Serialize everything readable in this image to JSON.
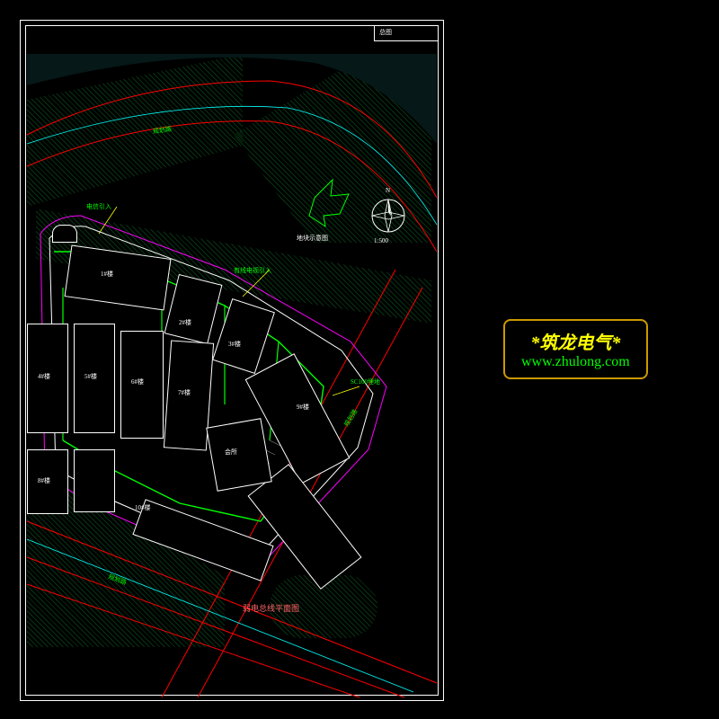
{
  "domain": "Diagram",
  "description": "CAD site plan — electrical weak-current layout of a residential/commercial block",
  "watermark": {
    "title": "*筑龙电气*",
    "url": "www.zhulong.com"
  },
  "title_block": {
    "label": "总图"
  },
  "compass": {
    "scale": "1:500",
    "north": "N"
  },
  "legend_label": "地块示意图",
  "plan_title": "弱电总线平面图",
  "buildings": {
    "b1": "1#楼",
    "b2": "2#楼",
    "b3": "3#楼",
    "b4": "4#楼",
    "b5": "5#楼",
    "b6": "6#楼",
    "b7": "7#楼",
    "b8": "8#楼",
    "b9": "9#楼",
    "b10": "10#楼",
    "hall": "会所"
  },
  "roads": {
    "r1": "规划路",
    "r2": "规划路",
    "r3": "规划路"
  },
  "notes": {
    "n1": "电信引入",
    "n2": "有线电视引入",
    "n3": "SC100埋地"
  },
  "colors": {
    "road_edge": "#f00",
    "cable": "#0f0",
    "outline": "#fff",
    "aux": "#0ff",
    "mag": "#f0f",
    "yel": "#ff0"
  }
}
